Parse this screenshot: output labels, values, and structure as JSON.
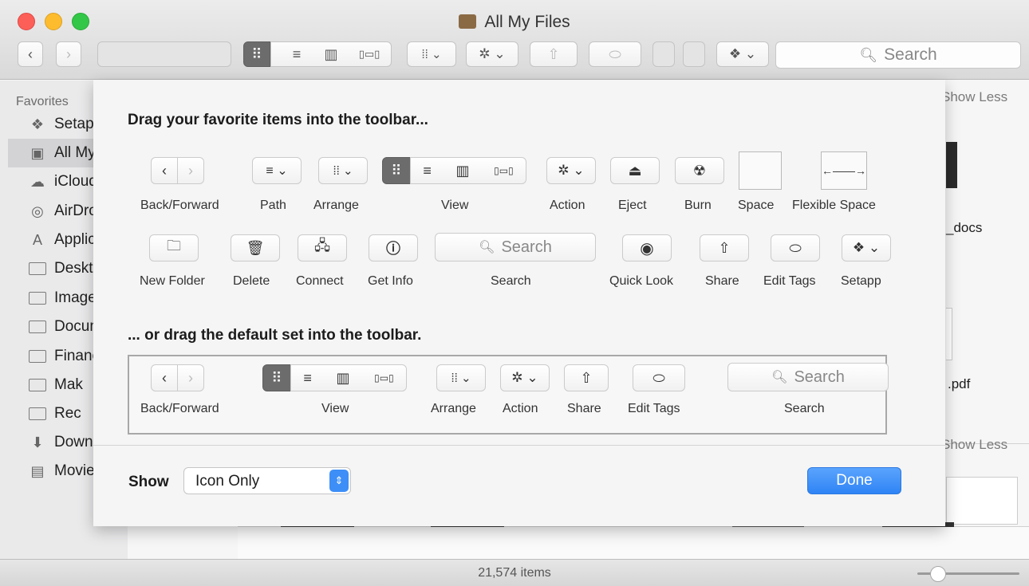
{
  "window": {
    "title": "All My Files"
  },
  "toolbar": {
    "back_glyph": "‹",
    "forward_glyph": "›",
    "view_icon": "⠿",
    "list_icon": "≡",
    "column_icon": "▥",
    "coverflow_icon": "▯▭▯",
    "arrange_icon": "⁞⁞ ⌄",
    "action_icon": "✲ ⌄",
    "share_icon": "⇧",
    "tags_icon": "⬭",
    "setapp_icon": "❖ ⌄",
    "search_placeholder": "Search"
  },
  "sidebar": {
    "section_label": "Favorites",
    "items": [
      {
        "label": "Setapp",
        "icon": "setapp-icon",
        "glyph": "❖"
      },
      {
        "label": "All My Files",
        "icon": "all-my-files-icon",
        "glyph": "▣"
      },
      {
        "label": "iCloud Drive",
        "icon": "cloud-icon",
        "glyph": "☁"
      },
      {
        "label": "AirDrop",
        "icon": "airdrop-icon",
        "glyph": "◎"
      },
      {
        "label": "Applications",
        "icon": "applications-icon",
        "glyph": "A"
      },
      {
        "label": "Desktop",
        "icon": "desktop-icon",
        "glyph": ""
      },
      {
        "label": "Images",
        "icon": "folder-icon",
        "glyph": ""
      },
      {
        "label": "Documents",
        "icon": "documents-icon",
        "glyph": ""
      },
      {
        "label": "Finance",
        "icon": "folder-icon",
        "glyph": ""
      },
      {
        "label": "Mak",
        "icon": "folder-icon",
        "glyph": ""
      },
      {
        "label": "Rec",
        "icon": "folder-icon",
        "glyph": ""
      },
      {
        "label": "Downloads",
        "icon": "download-icon",
        "glyph": "⬇"
      },
      {
        "label": "Movies",
        "icon": "movies-icon",
        "glyph": "▤"
      }
    ]
  },
  "background": {
    "show_less_1": "Show Less",
    "show_less_2": "Show Less",
    "file_docs": "_docs",
    "file_pdf": ".pdf"
  },
  "sheet": {
    "heading_favorites": "Drag your favorite items into the toolbar...",
    "heading_default": "... or drag the default set into the toolbar.",
    "row1": {
      "back_forward": "Back/Forward",
      "path": "Path",
      "arrange": "Arrange",
      "view": "View",
      "action": "Action",
      "eject": "Eject",
      "burn": "Burn",
      "space": "Space",
      "flexible_space": "Flexible Space"
    },
    "row2": {
      "new_folder": "New Folder",
      "delete": "Delete",
      "connect": "Connect",
      "get_info": "Get Info",
      "search": "Search",
      "search_placeholder": "Search",
      "quick_look": "Quick Look",
      "share": "Share",
      "edit_tags": "Edit Tags",
      "setapp": "Setapp"
    },
    "default_set": {
      "back_forward": "Back/Forward",
      "view": "View",
      "arrange": "Arrange",
      "action": "Action",
      "share": "Share",
      "edit_tags": "Edit Tags",
      "search": "Search",
      "search_placeholder": "Search"
    },
    "show_label": "Show",
    "show_value": "Icon Only",
    "done_label": "Done"
  },
  "status": {
    "item_count": "21,574 items",
    "zoom_level": 0.2
  }
}
